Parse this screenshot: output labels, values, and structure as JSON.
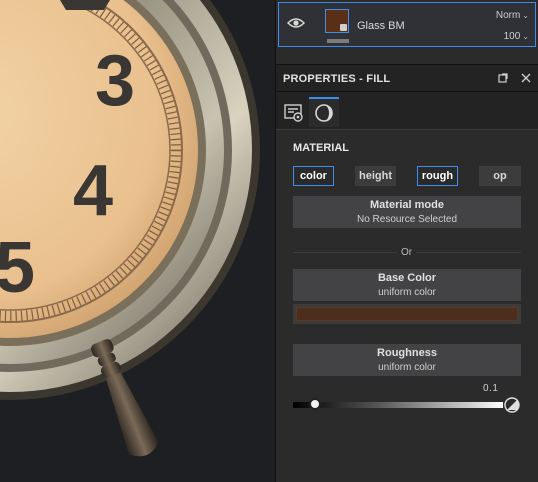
{
  "layer": {
    "name": "Glass BM",
    "blend_mode": "Norm",
    "opacity": "100"
  },
  "properties": {
    "title": "PROPERTIES - FILL"
  },
  "material": {
    "section_title": "MATERIAL",
    "channels": [
      {
        "label": "color",
        "active": true
      },
      {
        "label": "height",
        "active": false
      },
      {
        "label": "rough",
        "active": true
      },
      {
        "label": "op",
        "active": false
      }
    ],
    "mode_title": "Material mode",
    "mode_value": "No Resource Selected",
    "or_label": "Or",
    "base_color_title": "Base Color",
    "base_color_sub": "uniform color",
    "base_color_hex": "#4b2f1c",
    "roughness_title": "Roughness",
    "roughness_sub": "uniform color",
    "roughness_value": "0.1"
  },
  "colors": {
    "accent": "#3d8eea",
    "panel_bg": "#2b2b2c"
  }
}
